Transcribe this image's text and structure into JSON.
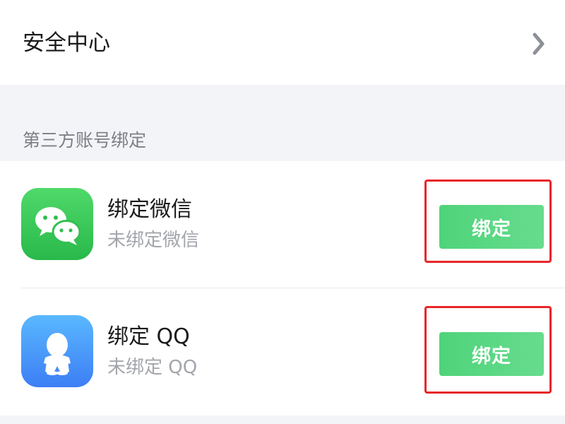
{
  "security_center": {
    "label": "安全中心",
    "chevron_icon": "chevron-right-icon"
  },
  "third_party": {
    "section_title": "第三方账号绑定",
    "items": [
      {
        "title": "绑定微信",
        "status": "未绑定微信",
        "button_label": "绑定",
        "icon": "wechat-icon",
        "icon_color": "#36c456"
      },
      {
        "title": "绑定 QQ",
        "status": "未绑定 QQ",
        "button_label": "绑定",
        "icon": "qq-icon",
        "icon_color": "#4a9af8"
      }
    ]
  },
  "colors": {
    "button_green": "#56d67f",
    "highlight_red": "#e8262a",
    "background": "#f3f4f7"
  }
}
